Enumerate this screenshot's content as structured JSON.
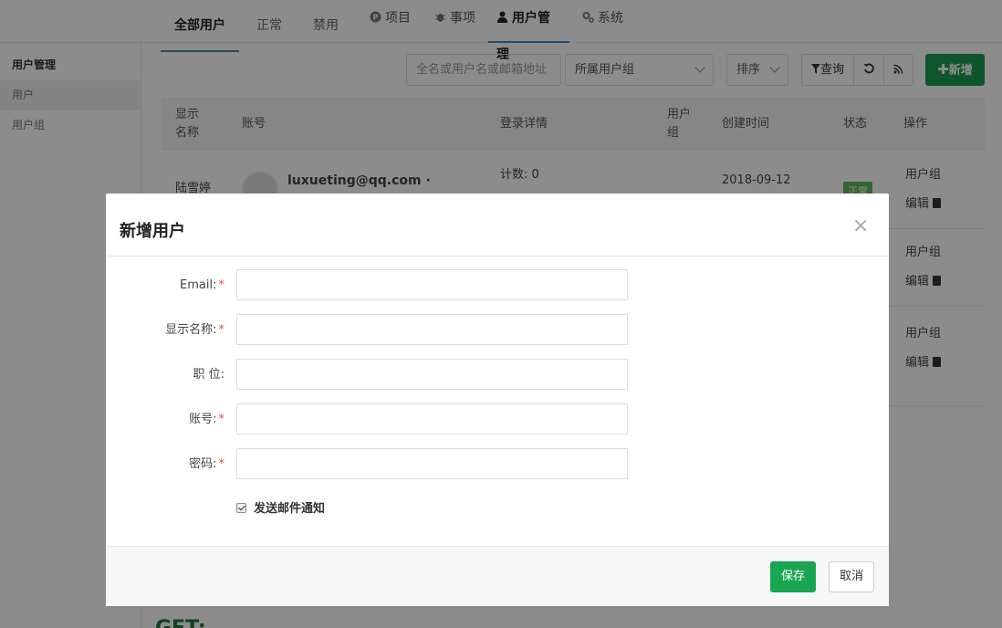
{
  "topnav": {
    "items": [
      {
        "label": "项目",
        "icon": "project-icon"
      },
      {
        "label": "事项",
        "icon": "bug-icon"
      },
      {
        "label": "用户管理",
        "icon": "user-icon"
      },
      {
        "label": "系统",
        "icon": "gears-icon"
      }
    ],
    "active_index": 2
  },
  "sidebar": {
    "title": "用户管理",
    "items": [
      {
        "label": "用户"
      },
      {
        "label": "用户组"
      }
    ],
    "active_index": 0
  },
  "tabs": [
    {
      "label": "全部用户"
    },
    {
      "label": "正常"
    },
    {
      "label": "禁用"
    }
  ],
  "toolbar": {
    "search_placeholder": "全名或用户名或邮箱地址",
    "group_select": "所属用户组",
    "sort_label": "排序",
    "query_label": "查询",
    "add_label": "新增"
  },
  "table": {
    "headers": [
      "显示\n名称",
      "账号",
      "登录详情",
      "用户\n组",
      "创建时间",
      "状态",
      "操作"
    ],
    "header_display_name": "显示",
    "header_display_name2": "名称",
    "header_account": "账号",
    "header_login": "登录详情",
    "header_group": "用户",
    "header_group2": "组",
    "header_created": "创建时间",
    "header_status": "状态",
    "header_ops": "操作",
    "rows": [
      {
        "display_name": "陆雪婷",
        "account": "luxueting@qq.com ·",
        "login": "计数: 0",
        "created": "2018-09-12",
        "status": "正常",
        "op_group": "用户组",
        "op_edit": "编辑"
      },
      {
        "op_group": "用户组",
        "op_edit": "编辑"
      },
      {
        "op_group": "用户组",
        "op_edit": "编辑"
      }
    ]
  },
  "background_heading": "GET:",
  "modal": {
    "title": "新增用户",
    "close_symbol": "×",
    "fields": [
      {
        "label": "Email:",
        "required": true,
        "value": ""
      },
      {
        "label": "显示名称:",
        "required": true,
        "value": ""
      },
      {
        "label": "职 位:",
        "required": false,
        "value": ""
      },
      {
        "label": "账号:",
        "required": true,
        "value": ""
      },
      {
        "label": "密码:",
        "required": true,
        "value": ""
      }
    ],
    "required_mark": "*",
    "notify_label": "发送邮件通知",
    "notify_checked": true,
    "save_label": "保存",
    "cancel_label": "取消"
  },
  "colors": {
    "primary_green": "#1a9b4f",
    "active_tab_border": "#4a8bc2",
    "required_red": "#d9534f",
    "status_green": "#5cb85c"
  }
}
